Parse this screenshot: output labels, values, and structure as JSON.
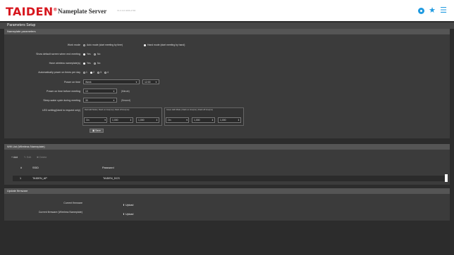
{
  "header": {
    "logo_text": "TAIDEN",
    "logo_reg": "®",
    "app_title": "Nameplate Server",
    "version": "V1.0.0.6 HMS-2700"
  },
  "page_title": "Parameters Setup",
  "nameplate": {
    "section_title": "Nameplate parameters",
    "work_mode": {
      "label": "Work mode",
      "opt1": "Auto mode (start meeting by time)",
      "opt2": "Hand mode (start meeting by hand)",
      "selected": 2
    },
    "show_default": {
      "label": "Show default screen when end meeting",
      "yes": "Yes",
      "no": "No",
      "selected": "yes"
    },
    "wireless": {
      "label": "Have wireless nameplate(s)",
      "yes": "Yes",
      "no": "No",
      "selected": "yes"
    },
    "auto_power": {
      "label": "Automatically power on times per day",
      "options": [
        "1",
        "2",
        "3",
        "4"
      ],
      "selected": 2
    },
    "power_on_time": {
      "label": "Power on time",
      "day_value": "Week",
      "time_value": "12:00"
    },
    "power_on_before": {
      "label": "Power on time before meeting",
      "value": "10",
      "unit": "(Minute)"
    },
    "sleep_wake": {
      "label": "Sleep-wake cycle during meeting",
      "value": "30",
      "unit": "(Second)"
    },
    "led": {
      "label": "LED setting(Used to request only)",
      "red_header": "Red LED Mode | Flash on time(ms) | Flash off time(ms)",
      "green_header": "Green LED Mode | Flash on time(ms) | Flash off time(ms)",
      "red_mode": "On",
      "red_on": "1,000",
      "red_off": "1,000",
      "green_mode": "On",
      "green_on": "1,000",
      "green_off": "1,000"
    },
    "save_label": "Save"
  },
  "wifi": {
    "section_title": "Wifi List (Wireless Nameplate)",
    "toolbar": {
      "add": "Add",
      "edit": "Edit",
      "delete": "Delete"
    },
    "columns": [
      "#",
      "SSID",
      "Password"
    ],
    "rows": [
      {
        "index": "1",
        "ssid": "TAIDEN_AP",
        "password": "TAIDEN_DCS"
      }
    ]
  },
  "firmware": {
    "section_title": "Update firmware",
    "current_label": "Current firmware",
    "wireless_label": "Current firmware (Wireless Nameplate)",
    "upload_label": "Upload"
  },
  "colors": {
    "accent": "#1f9ae0",
    "brand": "#d7161e",
    "panel": "#3b3b3b",
    "header_bar": "#555555"
  }
}
